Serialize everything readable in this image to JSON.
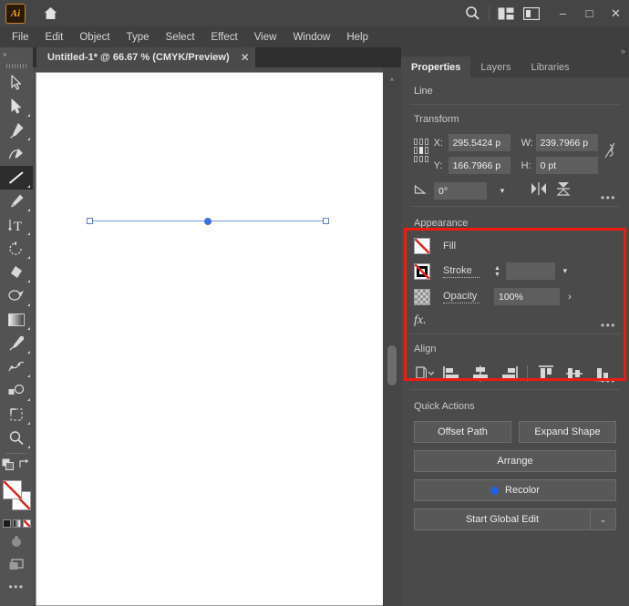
{
  "app": {
    "logo_text": "Ai",
    "home_icon": "home-icon",
    "search_icon": "search-icon",
    "arrange_icon": "arrange-documents-icon",
    "workspace_icon": "workspace-switcher-icon",
    "minimize": "–",
    "maximize": "□",
    "close": "✕"
  },
  "menubar": {
    "items": [
      {
        "label": "File"
      },
      {
        "label": "Edit"
      },
      {
        "label": "Object"
      },
      {
        "label": "Type"
      },
      {
        "label": "Select"
      },
      {
        "label": "Effect"
      },
      {
        "label": "View"
      },
      {
        "label": "Window"
      },
      {
        "label": "Help"
      }
    ]
  },
  "tabstrip": {
    "document_title": "Untitled-1* @ 66.67 % (CMYK/Preview)",
    "close_label": "✕",
    "collapse_label": "»"
  },
  "toolbar": {
    "collapse_label": "»",
    "tools": [
      {
        "name": "selection-tool",
        "label": "Selection"
      },
      {
        "name": "direct-selection-tool",
        "label": "Direct Selection"
      },
      {
        "name": "pen-tool",
        "label": "Pen"
      },
      {
        "name": "curvature-tool",
        "label": "Curvature"
      },
      {
        "name": "line-segment-tool",
        "label": "Line Segment",
        "active": true
      },
      {
        "name": "paintbrush-tool",
        "label": "Paintbrush"
      },
      {
        "name": "type-tool",
        "label": "Type"
      },
      {
        "name": "rotate-tool",
        "label": "Rotate"
      },
      {
        "name": "shape-builder-tool",
        "label": "Shape Builder"
      },
      {
        "name": "width-tool",
        "label": "Width"
      },
      {
        "name": "gradient-tool",
        "label": "Gradient"
      },
      {
        "name": "eyedropper-tool",
        "label": "Eyedropper"
      },
      {
        "name": "blend-tool",
        "label": "Blend"
      },
      {
        "name": "symbol-sprayer-tool",
        "label": "Symbol Sprayer"
      },
      {
        "name": "artboard-tool",
        "label": "Artboard"
      },
      {
        "name": "zoom-tool",
        "label": "Zoom"
      }
    ],
    "swatches": {
      "fill": "none",
      "stroke": "none",
      "color_none_label": "None",
      "gradient_label": "Gradient"
    },
    "more_dots": "•••"
  },
  "canvas": {
    "object": {
      "type": "line",
      "anchor_left": "anchor-point",
      "anchor_right": "anchor-point",
      "center_point": "center-point"
    }
  },
  "panel": {
    "tabs": [
      {
        "label": "Properties",
        "active": true
      },
      {
        "label": "Layers",
        "active": false
      },
      {
        "label": "Libraries",
        "active": false
      }
    ],
    "object_type": "Line",
    "transform": {
      "title": "Transform",
      "x_label": "X:",
      "x_value": "295.5424 p",
      "y_label": "Y:",
      "y_value": "166.7966 p",
      "w_label": "W:",
      "w_value": "239.7966 p",
      "h_label": "H:",
      "h_value": "0 pt",
      "angle_label": "△:",
      "angle_value": "0°",
      "link_icon": "constrain-proportions-icon",
      "flip_horizontal_icon": "flip-horizontal-icon",
      "flip_vertical_icon": "flip-vertical-icon",
      "more_dots": "•••"
    },
    "appearance": {
      "title": "Appearance",
      "fill_label": "Fill",
      "fill_value": "none",
      "stroke_label": "Stroke",
      "stroke_weight": "",
      "opacity_label": "Opacity",
      "opacity_value": "100%",
      "fx_label": "fx.",
      "more_dots": "•••",
      "highlight_color": "#ee1b11"
    },
    "align": {
      "title": "Align",
      "buttons": [
        {
          "name": "align-to-selection-dropdown",
          "label": "Align To"
        },
        {
          "name": "align-left-icon",
          "label": "Horizontal Align Left"
        },
        {
          "name": "align-center-h-icon",
          "label": "Horizontal Align Center"
        },
        {
          "name": "align-right-icon",
          "label": "Horizontal Align Right"
        },
        {
          "name": "align-top-icon",
          "label": "Vertical Align Top"
        },
        {
          "name": "align-center-v-icon",
          "label": "Vertical Align Center"
        },
        {
          "name": "align-bottom-icon",
          "label": "Vertical Align Bottom"
        }
      ],
      "more_dots": "•••"
    },
    "quick_actions": {
      "title": "Quick Actions",
      "offset_path": "Offset Path",
      "expand_shape": "Expand Shape",
      "arrange": "Arrange",
      "recolor": "Recolor",
      "recolor_dot_color": "#2060e8",
      "start_global_edit": "Start Global Edit",
      "global_edit_arrow": "⌄"
    },
    "collapse_label": "»"
  }
}
